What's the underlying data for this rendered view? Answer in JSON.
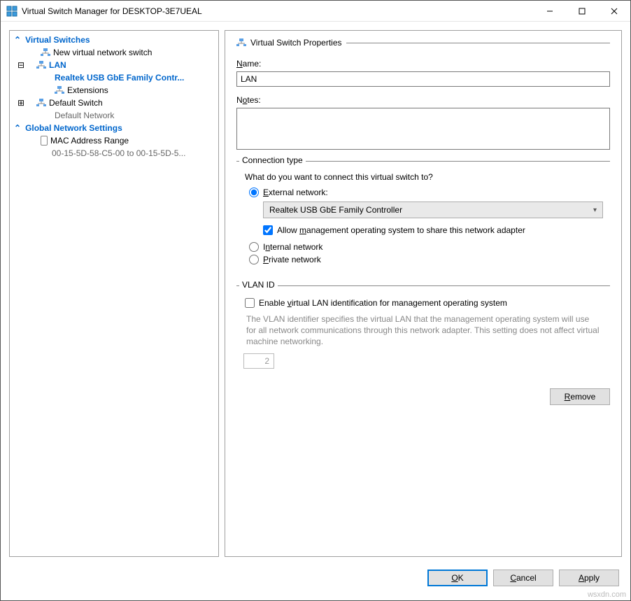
{
  "window": {
    "title": "Virtual Switch Manager for DESKTOP-3E7UEAL"
  },
  "tree": {
    "header_switches": "Virtual Switches",
    "new_switch": "New virtual network switch",
    "lan": "LAN",
    "lan_adapter": "Realtek USB GbE Family Contr...",
    "extensions": "Extensions",
    "default_switch": "Default Switch",
    "default_network": "Default Network",
    "header_global": "Global Network Settings",
    "mac_range": "MAC Address Range",
    "mac_range_val": "00-15-5D-58-C5-00 to 00-15-5D-5..."
  },
  "props": {
    "section_title": "Virtual Switch Properties",
    "name_label": "Name:",
    "name_value": "LAN",
    "notes_label": "Notes:",
    "notes_value": "",
    "conn_type_title": "Connection type",
    "conn_type_question": "What do you want to connect this virtual switch to?",
    "external_label": "External network:",
    "adapter_selected": "Realtek USB GbE Family Controller",
    "allow_mgmt": "Allow management operating system to share this network adapter",
    "internal_label": "Internal network",
    "private_label": "Private network",
    "vlan_title": "VLAN ID",
    "vlan_enable": "Enable virtual LAN identification for management operating system",
    "vlan_desc": "The VLAN identifier specifies the virtual LAN that the management operating system will use for all network communications through this network adapter. This setting does not affect virtual machine networking.",
    "vlan_value": "2",
    "remove": "Remove"
  },
  "buttons": {
    "ok": "OK",
    "cancel": "Cancel",
    "apply": "Apply"
  },
  "watermark": "wsxdn.com"
}
